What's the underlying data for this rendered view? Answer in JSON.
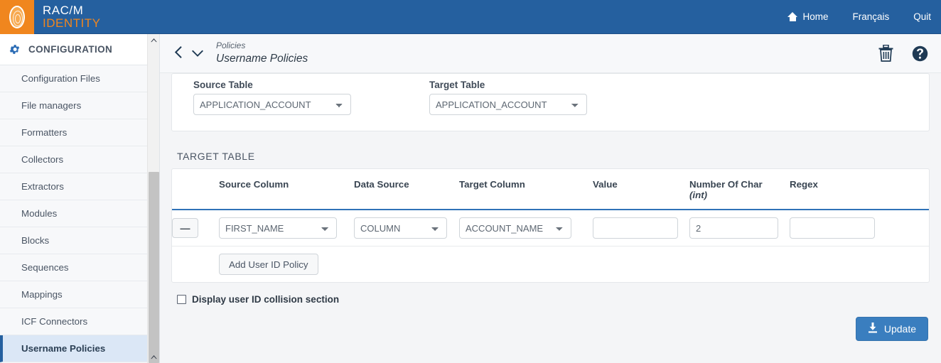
{
  "brand": {
    "line1": "RAC/M",
    "line2": "IDENTITY",
    "logo_bg": "#f0861e",
    "header_bg": "#25609f"
  },
  "topnav": [
    {
      "label": "Home",
      "icon": "home-icon"
    },
    {
      "label": "Français",
      "icon": ""
    },
    {
      "label": "Quit",
      "icon": ""
    }
  ],
  "sidebar": {
    "header": {
      "label": "CONFIGURATION",
      "icon": "gear-icon"
    },
    "items": [
      {
        "label": "Configuration Files",
        "active": false
      },
      {
        "label": "File managers",
        "active": false
      },
      {
        "label": "Formatters",
        "active": false
      },
      {
        "label": "Collectors",
        "active": false
      },
      {
        "label": "Extractors",
        "active": false
      },
      {
        "label": "Modules",
        "active": false
      },
      {
        "label": "Blocks",
        "active": false
      },
      {
        "label": "Sequences",
        "active": false
      },
      {
        "label": "Mappings",
        "active": false
      },
      {
        "label": "ICF Connectors",
        "active": false
      },
      {
        "label": "Username Policies",
        "active": true
      }
    ],
    "scrollbar": {
      "up_arrow": "▲",
      "down_arrow": "▼"
    }
  },
  "breadcrumb": {
    "back_icon": "chevron-left-icon",
    "down_icon": "chevron-down-icon",
    "parent": "Policies",
    "current": "Username Policies",
    "delete_icon": "trash-icon",
    "help_icon": "help-circle-icon"
  },
  "top_form": {
    "source_table": {
      "label": "Source Table",
      "value": "APPLICATION_ACCOUNT"
    },
    "target_table": {
      "label": "Target Table",
      "value": "APPLICATION_ACCOUNT"
    }
  },
  "target_table": {
    "section_title": "TARGET TABLE",
    "columns": [
      {
        "label": "Source Column",
        "sub": ""
      },
      {
        "label": "Data Source",
        "sub": ""
      },
      {
        "label": "Target Column",
        "sub": ""
      },
      {
        "label": "Value",
        "sub": ""
      },
      {
        "label": "Number Of Char",
        "sub": "(int)"
      },
      {
        "label": "Regex",
        "sub": ""
      }
    ],
    "rows": [
      {
        "remove_label": "—",
        "source_column": "FIRST_NAME",
        "data_source": "COLUMN",
        "target_column": "ACCOUNT_NAME",
        "value": "",
        "number_of_char": "2",
        "regex": ""
      }
    ],
    "add_button": "Add User ID Policy"
  },
  "collision": {
    "checkbox_label": "Display user ID collision section",
    "checked": false
  },
  "footer": {
    "update_label": "Update",
    "update_icon": "download-icon",
    "update_color": "#3a7ebf"
  }
}
